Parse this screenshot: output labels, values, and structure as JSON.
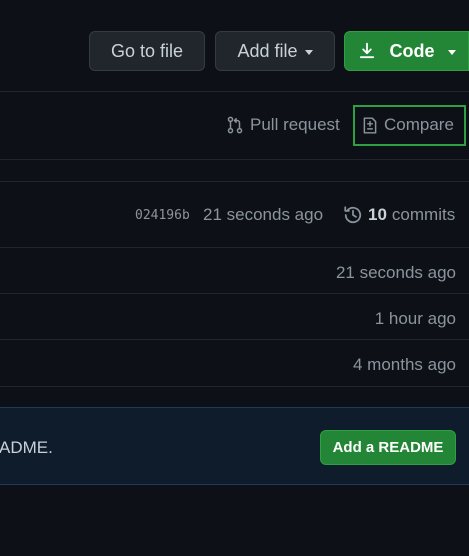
{
  "toolbar": {
    "go_to_file": "Go to file",
    "add_file": "Add file",
    "code": "Code"
  },
  "actions": {
    "pull_request": "Pull request",
    "compare": "Compare"
  },
  "commit_bar": {
    "sha": "024196b",
    "time": "21 seconds ago",
    "commit_count": "10",
    "commit_label": "commits"
  },
  "files": [
    {
      "time": "21 seconds ago"
    },
    {
      "time": "1 hour ago"
    },
    {
      "time": "4 months ago"
    }
  ],
  "readme_banner": {
    "text": "ADME.",
    "button": "Add a README"
  },
  "colors": {
    "background": "#0d1117",
    "primary_green": "#238636",
    "highlight_border": "#2ea043"
  }
}
